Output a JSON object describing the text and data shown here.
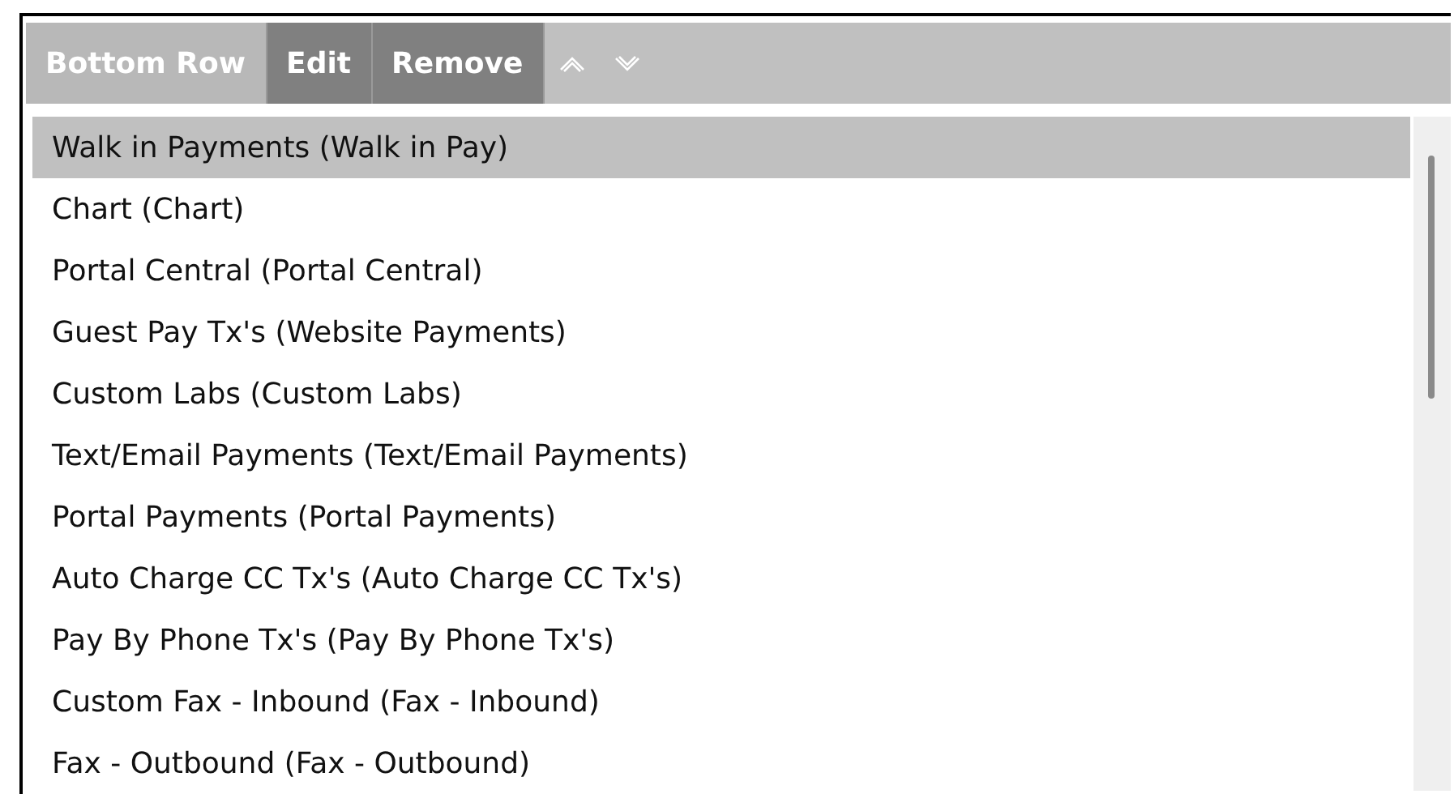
{
  "toolbar": {
    "buttons": [
      {
        "label": "Bottom Row",
        "disabled": true
      },
      {
        "label": "Edit",
        "disabled": false
      },
      {
        "label": "Remove",
        "disabled": false
      }
    ],
    "move_buttons": [
      {
        "kind": "up"
      },
      {
        "kind": "down"
      }
    ]
  },
  "list": {
    "items": [
      {
        "label": "Walk in Payments (Walk in Pay)",
        "selected": true
      },
      {
        "label": "Chart (Chart)",
        "selected": false
      },
      {
        "label": "Portal Central (Portal Central)",
        "selected": false
      },
      {
        "label": "Guest Pay Tx's (Website Payments)",
        "selected": false
      },
      {
        "label": "Custom Labs (Custom Labs)",
        "selected": false
      },
      {
        "label": "Text/Email Payments (Text/Email Payments)",
        "selected": false
      },
      {
        "label": "Portal Payments (Portal Payments)",
        "selected": false
      },
      {
        "label": "Auto Charge CC Tx's (Auto Charge CC Tx's)",
        "selected": false
      },
      {
        "label": "Pay By Phone Tx's (Pay By Phone Tx's)",
        "selected": false
      },
      {
        "label": "Custom Fax - Inbound (Fax - Inbound)",
        "selected": false
      },
      {
        "label": "Fax - Outbound (Fax - Outbound)",
        "selected": false
      }
    ]
  }
}
